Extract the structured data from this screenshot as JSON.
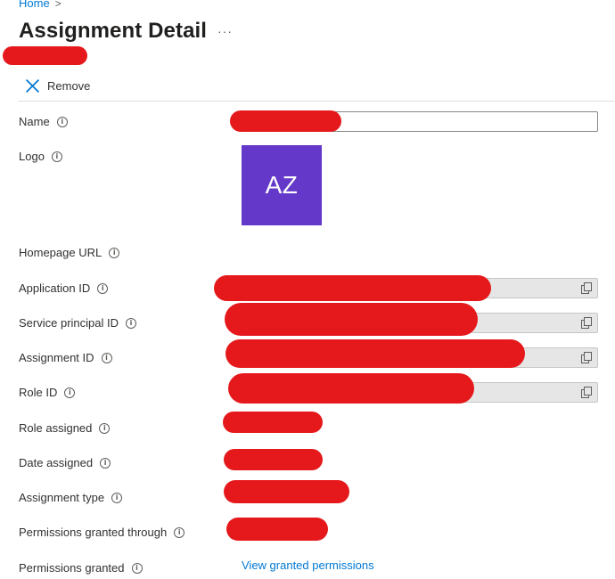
{
  "breadcrumb": {
    "home": "Home",
    "separator": ">"
  },
  "header": {
    "title": "Assignment Detail",
    "more": "···"
  },
  "toolbar": {
    "remove_label": "Remove"
  },
  "fields": {
    "name": "Name",
    "logo": "Logo",
    "homepage_url": "Homepage URL",
    "application_id": "Application ID",
    "service_principal_id": "Service principal ID",
    "assignment_id": "Assignment ID",
    "role_id": "Role ID",
    "role_assigned": "Role assigned",
    "date_assigned": "Date assigned",
    "assignment_type": "Assignment type",
    "permissions_granted_through": "Permissions granted through",
    "permissions_granted": "Permissions granted"
  },
  "logo": {
    "initials": "AZ",
    "color": "#6438c8"
  },
  "links": {
    "view_granted_permissions": "View granted permissions"
  },
  "icons": {
    "info": "i",
    "remove": "close-icon",
    "copy": "copy-icon"
  },
  "colors": {
    "accent": "#0078d4",
    "redaction": "#e5191c"
  }
}
